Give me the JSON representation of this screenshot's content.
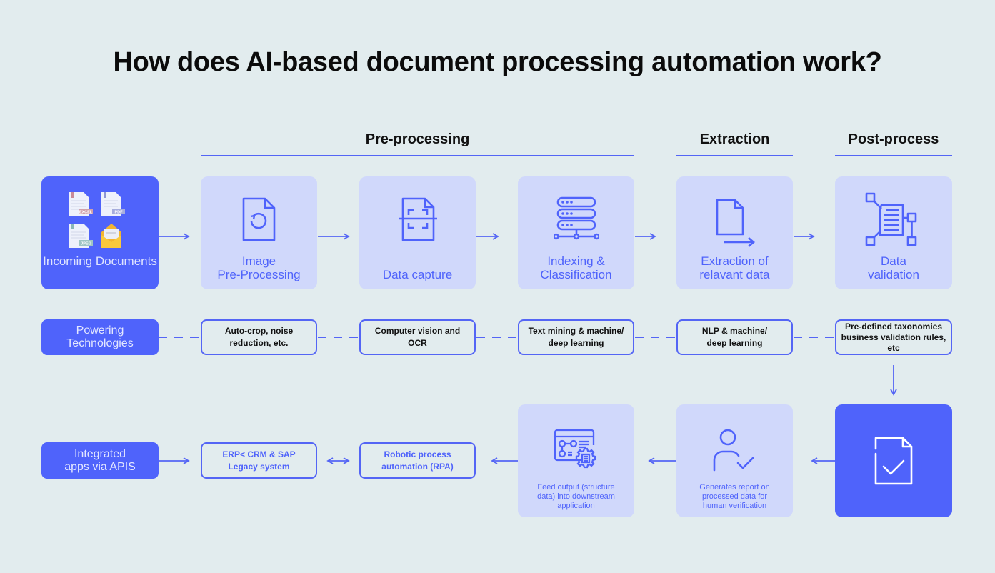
{
  "title": "How does AI-based document processing automation work?",
  "sections": [
    {
      "label": "Pre-processing"
    },
    {
      "label": "Extraction"
    },
    {
      "label": "Post-process"
    }
  ],
  "colors": {
    "background": "#e2ecee",
    "accent": "#4f63fb",
    "card_light": "#d0d8fb",
    "line": "#5465f5"
  },
  "top_row": [
    {
      "label": "Incoming Documents",
      "icon": "document-bundle-icon",
      "badges": [
        "EXCEL",
        "PDF",
        "JPEG"
      ]
    },
    {
      "label_line1": "Image",
      "label_line2": "Pre-Processing",
      "icon": "document-refresh-icon"
    },
    {
      "label": "Data capture",
      "icon": "document-scan-icon"
    },
    {
      "label_line1": "Indexing &",
      "label_line2": "Classification",
      "icon": "server-network-icon"
    },
    {
      "label_line1": "Extraction of",
      "label_line2": "relavant data",
      "icon": "document-export-icon"
    },
    {
      "label_line1": "Data",
      "label_line2": "validation",
      "icon": "document-network-icon"
    }
  ],
  "tech_row": {
    "header_line1": "Powering",
    "header_line2": "Technologies",
    "items": [
      {
        "line1": "Auto-crop, noise",
        "line2": "reduction, etc."
      },
      {
        "line1": "Computer vision and",
        "line2": "OCR"
      },
      {
        "line1": "Text mining & machine/",
        "line2": "deep learning"
      },
      {
        "line1": "NLP & machine/",
        "line2": "deep learning"
      },
      {
        "line1": "Pre-defined taxonomies",
        "line2": "business validation rules,",
        "line3": "etc"
      }
    ]
  },
  "bottom_row": {
    "header_line1": "Integrated",
    "header_line2": "apps via APIS",
    "systems": [
      {
        "line1": "ERP< CRM & SAP",
        "line2": "Legacy system"
      },
      {
        "line1": "Robotic process",
        "line2": "automation (RPA)"
      }
    ],
    "cards": [
      {
        "line1": "Feed output (structure",
        "line2": "data) into downstream",
        "line3": "application",
        "icon": "app-settings-icon"
      },
      {
        "line1": "Generates report on",
        "line2": "processed data for",
        "line3": "human verification",
        "icon": "user-check-icon"
      },
      {
        "icon": "document-check-icon"
      }
    ]
  }
}
